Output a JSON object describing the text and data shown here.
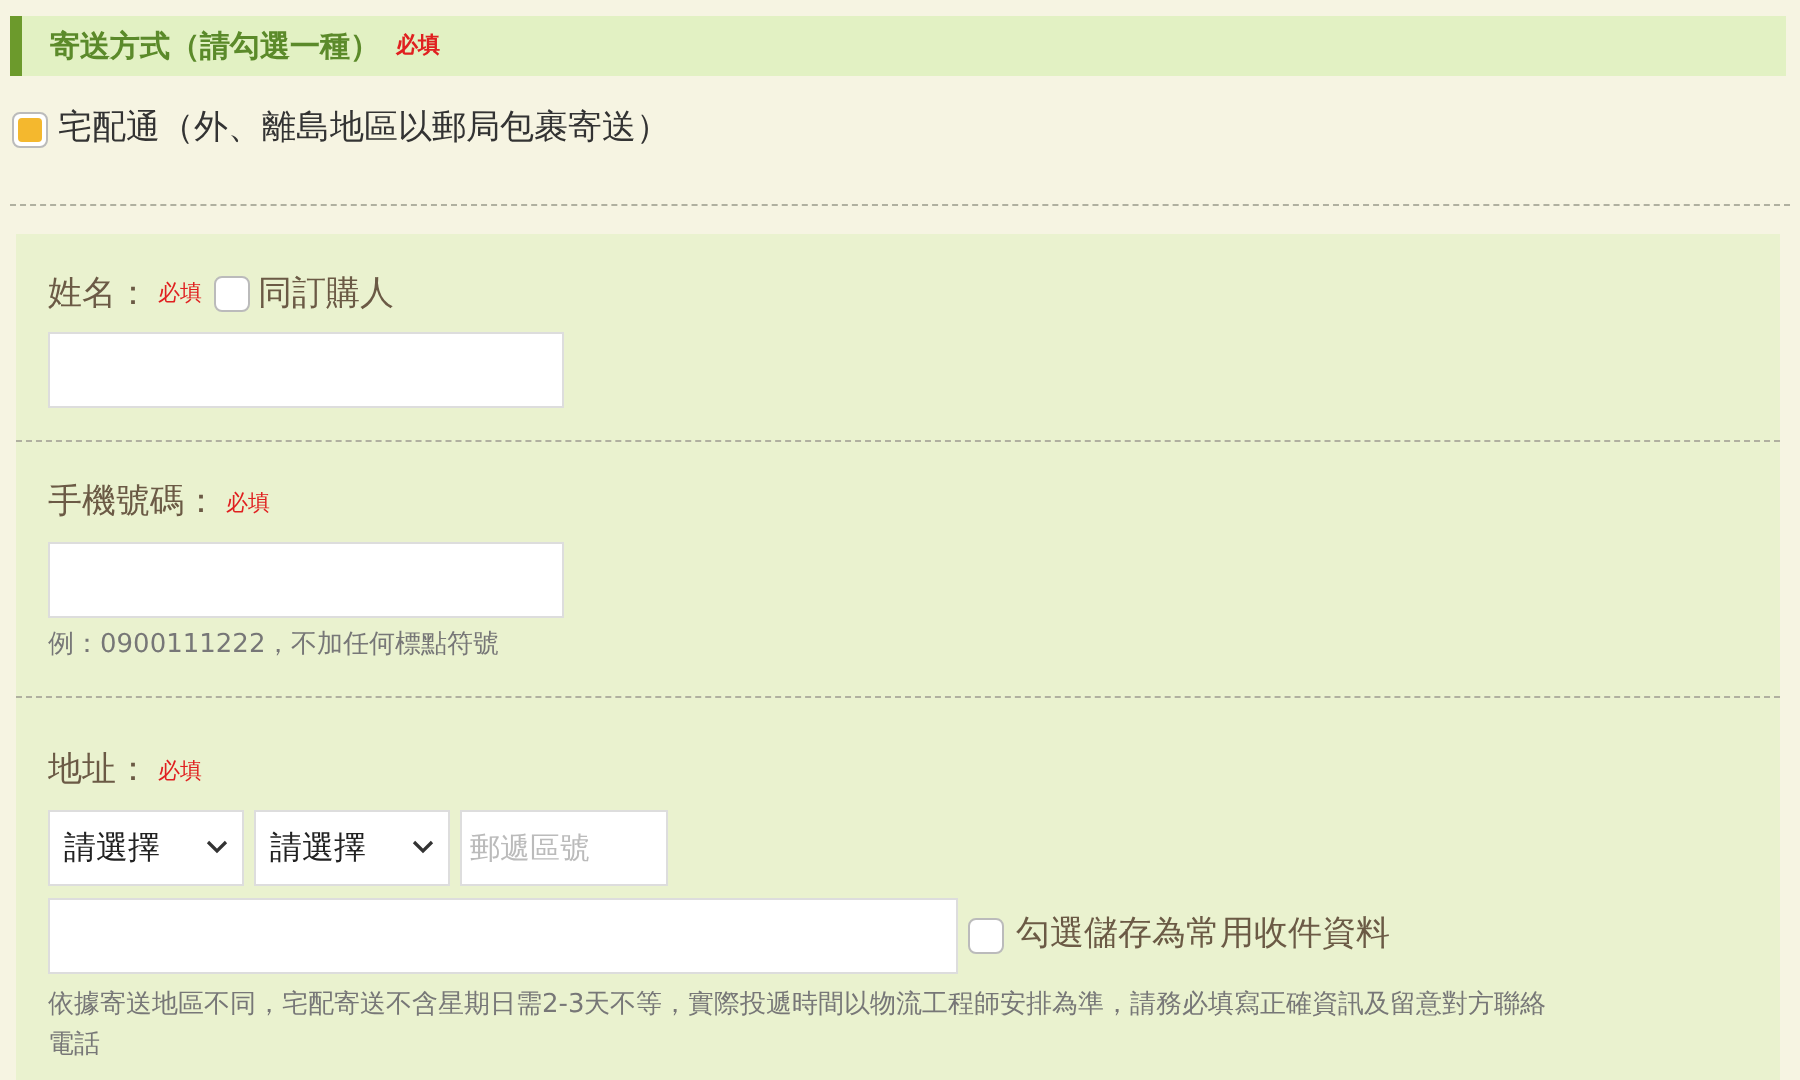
{
  "section": {
    "title": "寄送方式（請勾選一種）",
    "required_badge": "必填"
  },
  "options": [
    {
      "label": "宅配通（外、離島地區以郵局包裹寄送）",
      "checked": true
    }
  ],
  "fields": [
    {
      "kind": "text",
      "label": "姓名：",
      "required_badge": "必填",
      "same_as_buyer": {
        "label": "同訂購人",
        "checked": false
      }
    },
    {
      "kind": "text",
      "label": "手機號碼：",
      "required_badge": "必填",
      "hint": "例：0900111222，不加任何標點符號"
    },
    {
      "kind": "address",
      "label": "地址：",
      "required_badge": "必填",
      "selects": [
        {
          "value": "請選擇"
        },
        {
          "value": "請選擇"
        }
      ],
      "zip": {
        "placeholder": "郵遞區號"
      },
      "save_option": {
        "label": "勾選儲存為常用收件資料",
        "checked": false
      },
      "hint": "依據寄送地區不同，宅配寄送不含星期日需2-3天不等，實際投遞時間以物流工程師安排為準，請務必填寫正確資訊及留意對方聯絡電話"
    }
  ]
}
